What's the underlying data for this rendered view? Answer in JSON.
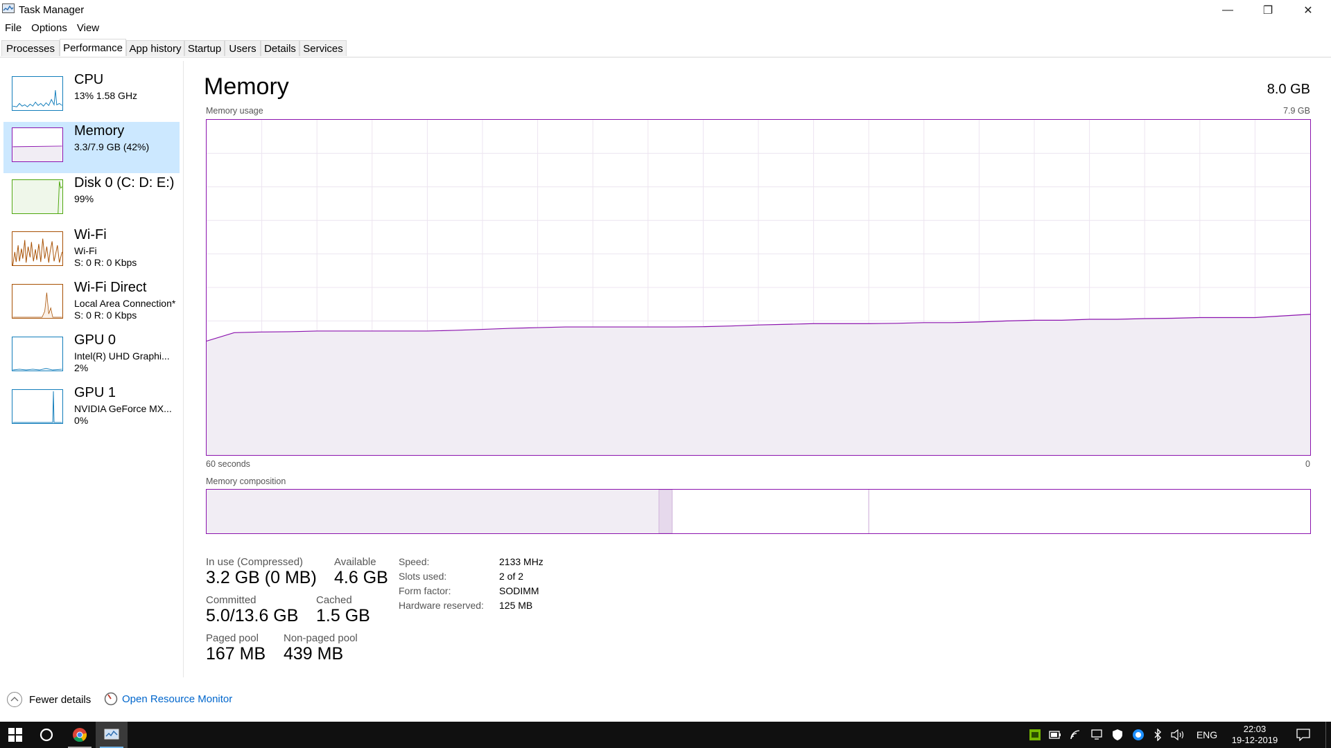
{
  "window": {
    "title": "Task Manager",
    "minimize_glyph": "—",
    "restore_glyph": "❐",
    "close_glyph": "✕"
  },
  "menu": [
    "File",
    "Options",
    "View"
  ],
  "tabs": [
    "Processes",
    "Performance",
    "App history",
    "Startup",
    "Users",
    "Details",
    "Services"
  ],
  "active_tab": "Performance",
  "sidebar": {
    "items": [
      {
        "title": "CPU",
        "line1": "13%  1.58 GHz",
        "line2": "",
        "color": "#117dbb"
      },
      {
        "title": "Memory",
        "line1": "3.3/7.9 GB (42%)",
        "line2": "",
        "color": "#8b12ae"
      },
      {
        "title": "Disk 0 (C: D: E:)",
        "line1": "99%",
        "line2": "",
        "color": "#4da60c"
      },
      {
        "title": "Wi-Fi",
        "line1": "Wi-Fi",
        "line2": "S: 0 R: 0 Kbps",
        "color": "#a74f01"
      },
      {
        "title": "Wi-Fi Direct",
        "line1": "Local Area Connection*",
        "line2": "S: 0 R: 0 Kbps",
        "color": "#a74f01"
      },
      {
        "title": "GPU 0",
        "line1": "Intel(R) UHD Graphi...",
        "line2": "2%",
        "color": "#117dbb"
      },
      {
        "title": "GPU 1",
        "line1": "NVIDIA GeForce MX...",
        "line2": "0%",
        "color": "#117dbb"
      }
    ]
  },
  "main": {
    "title": "Memory",
    "total": "8.0 GB",
    "usage_label": "Memory usage",
    "usage_max": "7.9 GB",
    "time_left": "60 seconds",
    "time_right": "0",
    "composition_label": "Memory composition",
    "usage_history_fraction": [
      0.34,
      0.365,
      0.367,
      0.368,
      0.37,
      0.37,
      0.37,
      0.37,
      0.37,
      0.372,
      0.375,
      0.378,
      0.38,
      0.382,
      0.382,
      0.382,
      0.382,
      0.382,
      0.383,
      0.385,
      0.388,
      0.39,
      0.392,
      0.392,
      0.392,
      0.393,
      0.395,
      0.395,
      0.397,
      0.4,
      0.402,
      0.402,
      0.405,
      0.405,
      0.407,
      0.408,
      0.41,
      0.41,
      0.41,
      0.415,
      0.42
    ],
    "composition": {
      "in_use": 0.41,
      "modified": 0.012,
      "standby": 0.178,
      "free": 0.4
    },
    "stats": {
      "in_use_label": "In use (Compressed)",
      "in_use_value": "3.2 GB (0 MB)",
      "available_label": "Available",
      "available_value": "4.6 GB",
      "committed_label": "Committed",
      "committed_value": "5.0/13.6 GB",
      "cached_label": "Cached",
      "cached_value": "1.5 GB",
      "paged_label": "Paged pool",
      "paged_value": "167 MB",
      "nonpaged_label": "Non-paged pool",
      "nonpaged_value": "439 MB"
    },
    "specs": {
      "speed_label": "Speed:",
      "speed_value": "2133 MHz",
      "slots_label": "Slots used:",
      "slots_value": "2 of 2",
      "form_label": "Form factor:",
      "form_value": "SODIMM",
      "reserved_label": "Hardware reserved:",
      "reserved_value": "125 MB"
    },
    "accent": "#8b12ae",
    "fill": "#f1edf4"
  },
  "footer": {
    "fewer_details": "Fewer details",
    "open_resource_monitor": "Open Resource Monitor"
  },
  "taskbar": {
    "language": "ENG",
    "time": "22:03",
    "date": "19-12-2019"
  }
}
